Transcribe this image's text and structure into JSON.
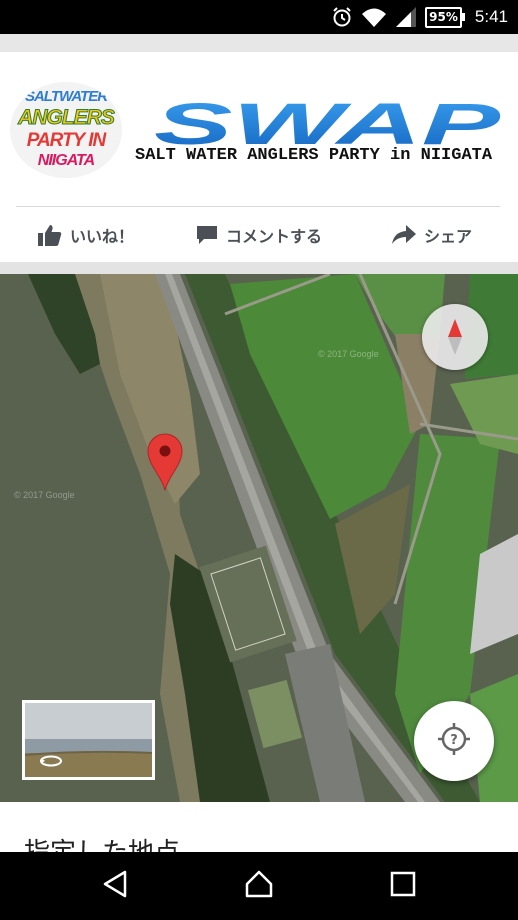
{
  "status_bar": {
    "battery": "95%",
    "time": "5:41",
    "icons": [
      "alarm-icon",
      "wifi-icon",
      "cell-signal-icon",
      "battery-icon"
    ]
  },
  "banner": {
    "logo_lines": [
      "SALTWATER",
      "ANGLERS",
      "PARTY IN",
      "NIIGATA"
    ],
    "brand": "SWAP",
    "subtitle": "SALT WATER ANGLERS PARTY in NIIGATA",
    "colors": {
      "brand_blue": "#1e88e5",
      "brand_blue_dark": "#1565c0"
    }
  },
  "actions": {
    "like": "いいね！",
    "comment": "コメントする",
    "share": "シェア"
  },
  "map": {
    "watermark": "© 2017 Google",
    "controls": [
      "compass-icon",
      "my-location-icon",
      "street-view-rotate-icon"
    ],
    "pin_color": "#e53935"
  },
  "card": {
    "title": "指定した地点"
  },
  "nav": {
    "icons": [
      "back-icon",
      "home-icon",
      "recents-icon"
    ]
  }
}
